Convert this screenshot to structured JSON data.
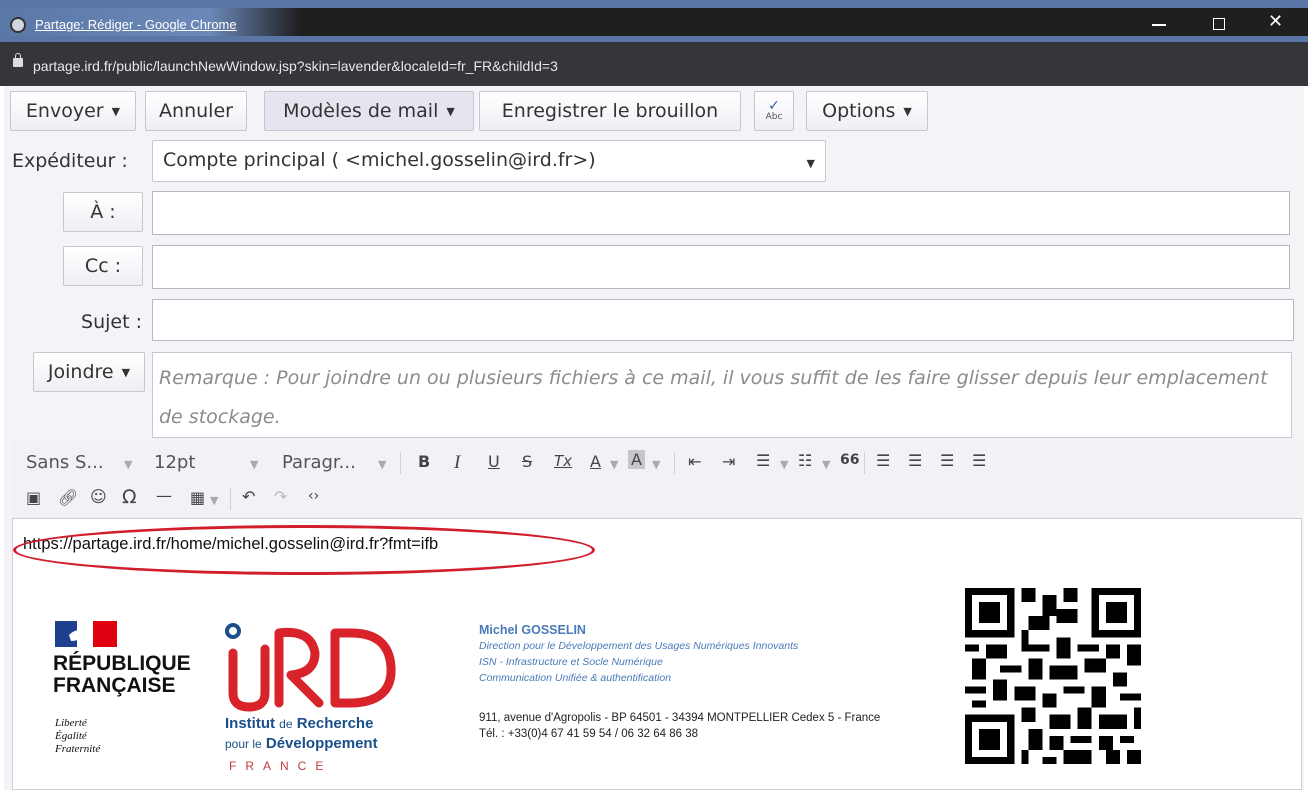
{
  "window": {
    "title": "Partage: Rédiger - Google Chrome",
    "url": "partage.ird.fr/public/launchNewWindow.jsp?skin=lavender&localeId=fr_FR&childId=3",
    "controls": {
      "minimize": "",
      "maximize": "",
      "close": "✕"
    }
  },
  "toolbar": {
    "send": "Envoyer",
    "cancel": "Annuler",
    "templates": "Modèles de mail",
    "save_draft": "Enregistrer le brouillon",
    "spellcheck_icon": "spellcheck-icon",
    "spellcheck_text": "Abc",
    "options": "Options"
  },
  "form": {
    "from_label": "Expéditeur :",
    "from_value": "Compte principal ( <michel.gosselin@ird.fr>)",
    "to_label": "À :",
    "to_value": "",
    "cc_label": "Cc :",
    "cc_value": "",
    "subject_label": "Sujet :",
    "subject_value": "",
    "attach_label": "Joindre",
    "attach_note": "Remarque : Pour joindre un ou plusieurs fichiers à ce mail, il vous suffit de les faire glisser depuis leur emplacement de stockage."
  },
  "editor_toolbar": {
    "font_family": "Sans S...",
    "font_size": "12pt",
    "paragraph": "Paragr...",
    "bold": "B",
    "italic": "I",
    "underline": "U",
    "strike": "S",
    "clear_format": "Tx",
    "text_color": "A",
    "bg_color": "A",
    "blockquote": "66",
    "omega": "Ω"
  },
  "body": {
    "link": "https://partage.ird.fr/home/michel.gosselin@ird.fr?fmt=ifb",
    "highlight_color": "#d01f2a"
  },
  "signature": {
    "republique_line1": "RÉPUBLIQUE",
    "republique_line2": "FRANÇAISE",
    "motto1": "Liberté",
    "motto2": "Égalité",
    "motto3": "Fraternité",
    "ird_line1a": "Institut",
    "ird_line1b": "de",
    "ird_line1c": "Recherche",
    "ird_line2a": "pour le",
    "ird_line2b": "Développement",
    "ird_line3": "FRANCE",
    "name": "Michel GOSSELIN",
    "dept1": "Direction pour le Développement des Usages Numériques Innovants",
    "dept2": "ISN - Infrastructure et Socle Numérique",
    "dept3": "Communication Unifiée & authentification",
    "address": "911, avenue d'Agropolis - BP 64501 - 34394 MONTPELLIER Cedex 5 - France",
    "phone": "Tél. : +33(0)4 67 41 59 54 / 06 32 64 86 38"
  },
  "colors": {
    "accent": "#e7e4f0",
    "ird_blue": "#1a4f8b",
    "ird_red": "#d8232a",
    "signature_blue": "#4a7ab8"
  }
}
